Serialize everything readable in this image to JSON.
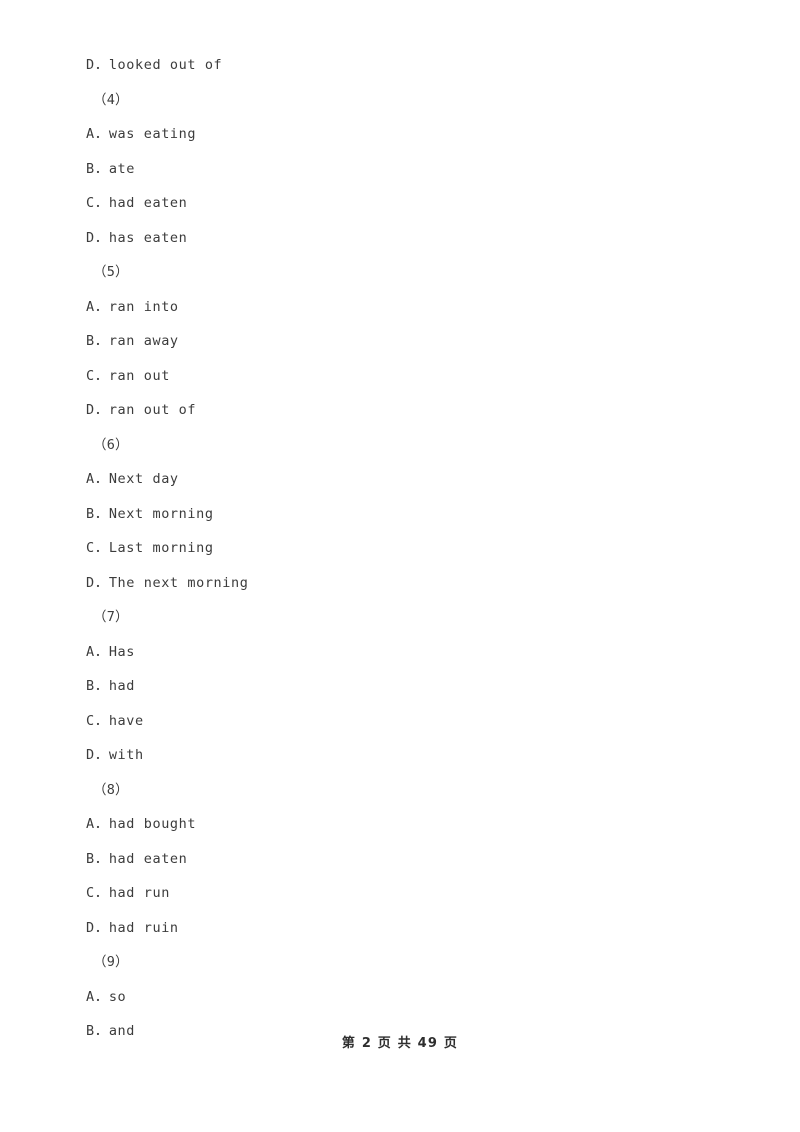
{
  "document": {
    "blocks": [
      {
        "kind": "option",
        "text": "D．looked out of"
      },
      {
        "kind": "group",
        "text": "（4）"
      },
      {
        "kind": "option",
        "text": "A．was eating"
      },
      {
        "kind": "option",
        "text": "B．ate"
      },
      {
        "kind": "option",
        "text": "C．had eaten"
      },
      {
        "kind": "option",
        "text": "D．has eaten"
      },
      {
        "kind": "group",
        "text": "（5）"
      },
      {
        "kind": "option",
        "text": "A．ran into"
      },
      {
        "kind": "option",
        "text": "B．ran away"
      },
      {
        "kind": "option",
        "text": "C．ran out"
      },
      {
        "kind": "option",
        "text": "D．ran out of"
      },
      {
        "kind": "group",
        "text": "（6）"
      },
      {
        "kind": "option",
        "text": "A．Next day"
      },
      {
        "kind": "option",
        "text": "B．Next morning"
      },
      {
        "kind": "option",
        "text": "C．Last morning"
      },
      {
        "kind": "option",
        "text": "D．The next morning"
      },
      {
        "kind": "group",
        "text": "（7）"
      },
      {
        "kind": "option",
        "text": "A．Has"
      },
      {
        "kind": "option",
        "text": "B．had"
      },
      {
        "kind": "option",
        "text": "C．have"
      },
      {
        "kind": "option",
        "text": "D．with"
      },
      {
        "kind": "group",
        "text": "（8）"
      },
      {
        "kind": "option",
        "text": "A．had bought"
      },
      {
        "kind": "option",
        "text": "B．had eaten"
      },
      {
        "kind": "option",
        "text": "C．had run"
      },
      {
        "kind": "option",
        "text": "D．had ruin"
      },
      {
        "kind": "group",
        "text": "（9）"
      },
      {
        "kind": "option",
        "text": "A．so"
      },
      {
        "kind": "option",
        "text": "B．and"
      }
    ]
  },
  "footer": {
    "text": "第 2 页 共 49 页",
    "current_page": "2",
    "total_pages": "49"
  },
  "colors": {
    "page_background": "#ffffff",
    "body_text": "#3c3c3c",
    "footer_text": "#2e2e2e"
  }
}
